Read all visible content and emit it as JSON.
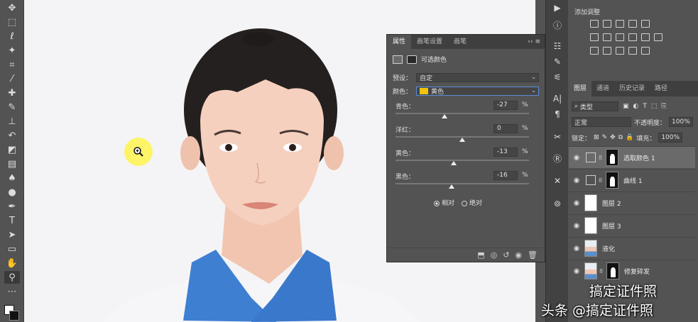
{
  "toolbar": {
    "tools": [
      "move-tool",
      "marquee-tool",
      "lasso-tool",
      "magic-wand-tool",
      "crop-tool",
      "eyedropper-tool",
      "healing-brush-tool",
      "brush-tool",
      "clone-stamp-tool",
      "history-brush-tool",
      "eraser-tool",
      "gradient-tool",
      "blur-tool",
      "dodge-tool",
      "pen-tool",
      "type-tool",
      "path-selection-tool",
      "rectangle-tool",
      "hand-tool",
      "zoom-tool",
      "more-tools"
    ]
  },
  "properties": {
    "tabs": [
      "属性",
      "画笔设置",
      "画笔"
    ],
    "title": "可选颜色",
    "preset_label": "预设：",
    "preset_value": "自定",
    "color_label": "颜色：",
    "color_value": "黄色",
    "color_swatch": "#f2c20f",
    "sliders": [
      {
        "label": "青色：",
        "value": "-27",
        "unit": "%",
        "level": -27
      },
      {
        "label": "洋红：",
        "value": "0",
        "unit": "%",
        "level": 0
      },
      {
        "label": "黄色：",
        "value": "-13",
        "unit": "%",
        "level": -13
      },
      {
        "label": "黑色：",
        "value": "-16",
        "unit": "%",
        "level": -16
      }
    ],
    "method_relative": "相对",
    "method_absolute": "绝对",
    "selected_method": "relative"
  },
  "adjustments": {
    "title": "添加调整"
  },
  "layers_panel": {
    "tabs": [
      "图层",
      "通道",
      "历史记录",
      "路径"
    ],
    "filter_kind": "类型",
    "blend_mode": "正常",
    "opacity_label": "不透明度：",
    "opacity_value": "100%",
    "lock_label": "锁定：",
    "fill_label": "填充：",
    "fill_value": "100%",
    "layers": [
      {
        "name": "选取颜色 1",
        "selected": true
      },
      {
        "name": "曲线 1",
        "selected": false
      },
      {
        "name": "图层 2",
        "selected": false
      },
      {
        "name": "图层 3",
        "selected": false
      },
      {
        "name": "液化",
        "selected": false
      },
      {
        "name": "修复碎发",
        "selected": false
      }
    ]
  },
  "watermark": {
    "line1": "搞定证件照",
    "line2": "头条 @搞定证件照"
  }
}
